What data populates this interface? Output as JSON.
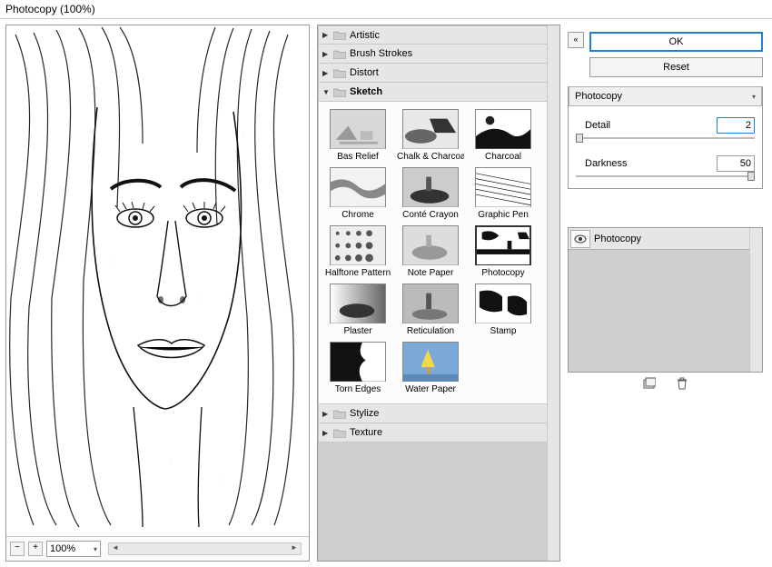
{
  "window": {
    "title": "Photocopy (100%)"
  },
  "preview_controls": {
    "zoom_out_label": "−",
    "zoom_in_label": "+",
    "zoom_value": "100%"
  },
  "categories": [
    {
      "id": "artistic",
      "label": "Artistic",
      "expanded": false
    },
    {
      "id": "brush-strokes",
      "label": "Brush Strokes",
      "expanded": false
    },
    {
      "id": "distort",
      "label": "Distort",
      "expanded": false
    },
    {
      "id": "sketch",
      "label": "Sketch",
      "expanded": true,
      "filters": [
        {
          "id": "bas-relief",
          "label": "Bas Relief"
        },
        {
          "id": "chalk-charcoal",
          "label": "Chalk & Charcoal"
        },
        {
          "id": "charcoal",
          "label": "Charcoal"
        },
        {
          "id": "chrome",
          "label": "Chrome"
        },
        {
          "id": "conte-crayon",
          "label": "Conté Crayon"
        },
        {
          "id": "graphic-pen",
          "label": "Graphic Pen"
        },
        {
          "id": "halftone-pattern",
          "label": "Halftone Pattern"
        },
        {
          "id": "note-paper",
          "label": "Note Paper"
        },
        {
          "id": "photocopy",
          "label": "Photocopy",
          "selected": true
        },
        {
          "id": "plaster",
          "label": "Plaster"
        },
        {
          "id": "reticulation",
          "label": "Reticulation"
        },
        {
          "id": "stamp",
          "label": "Stamp"
        },
        {
          "id": "torn-edges",
          "label": "Torn Edges"
        },
        {
          "id": "water-paper",
          "label": "Water Paper"
        }
      ]
    },
    {
      "id": "stylize",
      "label": "Stylize",
      "expanded": false
    },
    {
      "id": "texture",
      "label": "Texture",
      "expanded": false
    }
  ],
  "buttons": {
    "ok": "OK",
    "reset": "Reset"
  },
  "settings": {
    "selected_filter": "Photocopy",
    "params": [
      {
        "id": "detail",
        "label": "Detail",
        "value": "2",
        "pos_pct": 0
      },
      {
        "id": "darkness",
        "label": "Darkness",
        "value": "50",
        "pos_pct": 100
      }
    ]
  },
  "layers": {
    "items": [
      {
        "id": "photocopy",
        "label": "Photocopy",
        "visible": true
      }
    ],
    "new_tooltip": "New effect layer",
    "delete_tooltip": "Delete effect layer"
  },
  "icons": {
    "collapse": "«"
  }
}
